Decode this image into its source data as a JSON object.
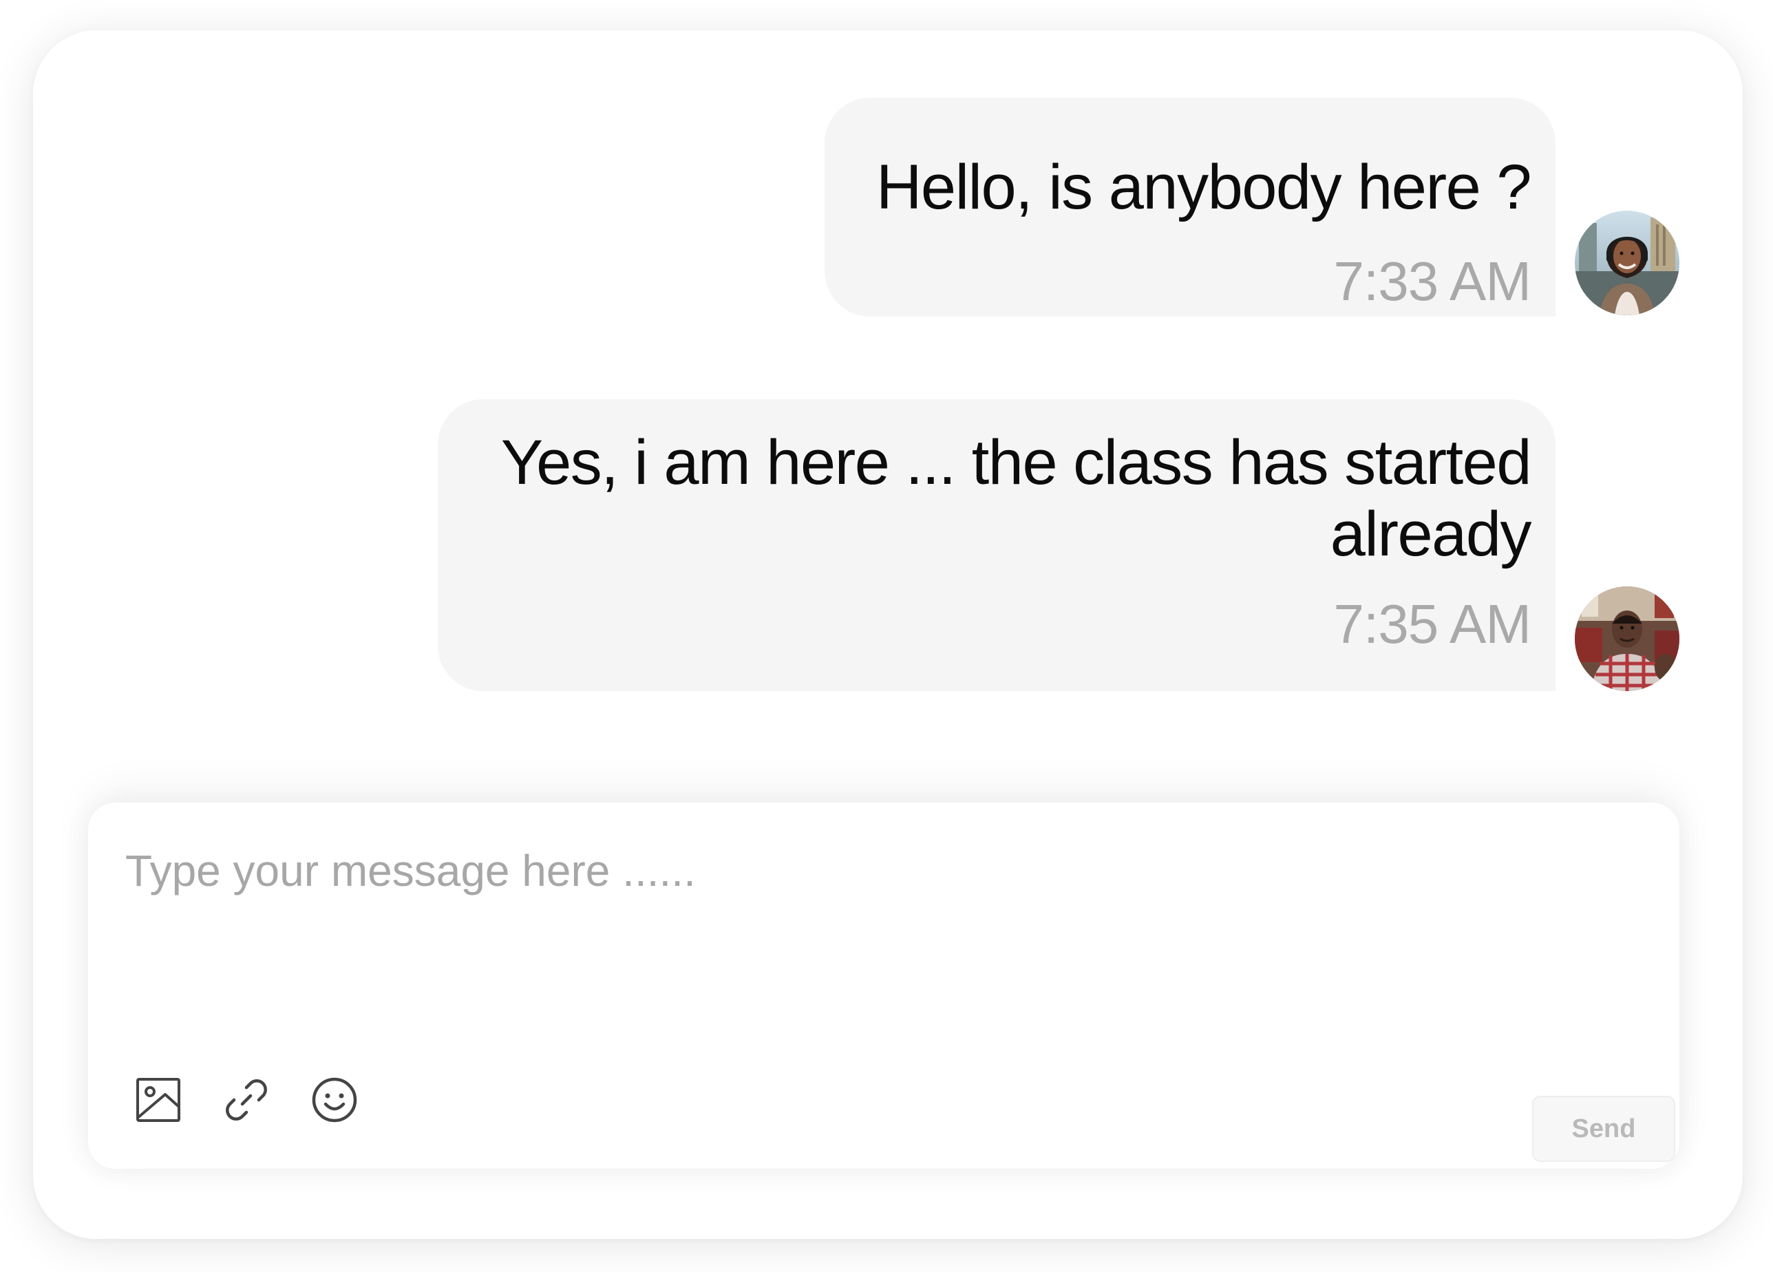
{
  "messages": [
    {
      "text": "Hello, is anybody here ?",
      "time": "7:33 AM",
      "avatar": "avatar-woman-headset"
    },
    {
      "text": "Yes, i am here ... the class has started already",
      "time": "7:35 AM",
      "avatar": "avatar-man-plaid-shirt"
    }
  ],
  "composer": {
    "placeholder": "Type your message here ......",
    "value": "",
    "send_label": "Send",
    "tools": [
      "image-icon",
      "link-icon",
      "emoji-icon"
    ]
  },
  "colors": {
    "bubble_bg": "#f5f5f5",
    "timestamp": "#a9a9a9",
    "placeholder": "#a7a7a7",
    "icon": "#444444"
  }
}
